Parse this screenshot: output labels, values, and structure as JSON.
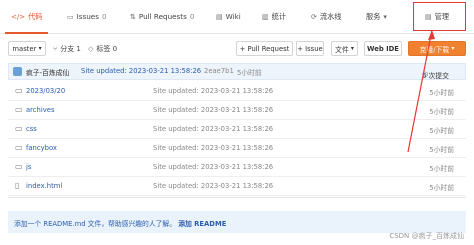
{
  "nav": {
    "tabs": [
      {
        "icon": "</>",
        "label": "代码"
      },
      {
        "icon": "▭",
        "label": "Issues",
        "count": "0"
      },
      {
        "icon": "⇅",
        "label": "Pull Requests",
        "count": "0"
      },
      {
        "icon": "▤",
        "label": "Wiki"
      },
      {
        "icon": "▥",
        "label": "统计"
      },
      {
        "icon": "⟳",
        "label": "流水线"
      },
      {
        "icon": "⚙",
        "label": "服务",
        "caret": "▾"
      },
      {
        "icon": "▤",
        "label": "管理"
      }
    ]
  },
  "toolbar": {
    "branch": "master",
    "branch_caret": "▾",
    "branches_label": "分支 1",
    "tags_label": "标签 0",
    "pull_request": "+ Pull Request",
    "issue": "+ Issue",
    "file_menu": "文件",
    "web_ide": "Web IDE",
    "clone": "克隆/下载"
  },
  "commit": {
    "author": "疯子-百炼成仙",
    "message": "Site updated: 2023-03-21 13:58:26",
    "hash": "2eae7b1",
    "time": "5小时前",
    "commits": "6 次提交"
  },
  "files": [
    {
      "icon": "folder",
      "name": "2023/03/20",
      "message": "Site updated: 2023-03-21 13:58:26",
      "time": "5小时前"
    },
    {
      "icon": "folder",
      "name": "archives",
      "message": "Site updated: 2023-03-21 13:58:26",
      "time": "5小时前"
    },
    {
      "icon": "folder",
      "name": "css",
      "message": "Site updated: 2023-03-21 13:58:26",
      "time": "5小时前"
    },
    {
      "icon": "folder",
      "name": "fancybox",
      "message": "Site updated: 2023-03-21 13:58:26",
      "time": "5小时前"
    },
    {
      "icon": "folder",
      "name": "js",
      "message": "Site updated: 2023-03-21 13:58:26",
      "time": "5小时前"
    },
    {
      "icon": "file",
      "name": "index.html",
      "message": "Site updated: 2023-03-21 13:58:26",
      "time": "5小时前"
    }
  ],
  "readme": {
    "text": "添加一个 README.md 文件，帮助感兴趣的人了解。",
    "link": "添加 README"
  },
  "watermark": "CSDN @疯子_百炼成仙",
  "colors": {
    "accent": "#e5572f",
    "annotation": "#e53935",
    "link": "#2a5db0"
  }
}
